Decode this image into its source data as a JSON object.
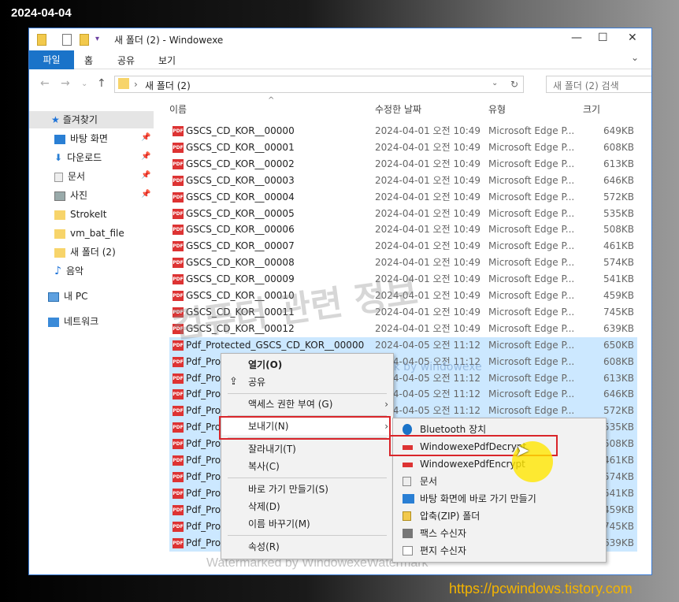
{
  "date_stamp": "2024-04-04",
  "site_url": "https://pcwindows.tistory.com",
  "window": {
    "title": "새 폴더 (2)  - Windowexe"
  },
  "ribbon": {
    "tabs": [
      "파일",
      "홈",
      "공유",
      "보기"
    ]
  },
  "address": {
    "path": "새 폴더 (2)",
    "search_placeholder": "새 폴더 (2) 검색"
  },
  "sidebar": {
    "items": [
      {
        "label": "즐겨찾기",
        "icon": "star-icon",
        "pinned": false
      },
      {
        "label": "바탕 화면",
        "icon": "desktop-icon",
        "pinned": true
      },
      {
        "label": "다운로드",
        "icon": "download-icon",
        "pinned": true
      },
      {
        "label": "문서",
        "icon": "document-icon",
        "pinned": true
      },
      {
        "label": "사진",
        "icon": "picture-icon",
        "pinned": true
      },
      {
        "label": "StrokeIt",
        "icon": "folder-icon",
        "pinned": false
      },
      {
        "label": "vm_bat_file",
        "icon": "folder-icon",
        "pinned": false
      },
      {
        "label": "새 폴더 (2)",
        "icon": "folder-icon",
        "pinned": false
      },
      {
        "label": "음악",
        "icon": "music-icon",
        "pinned": false
      },
      {
        "label": "내 PC",
        "icon": "pc-icon",
        "pinned": false
      },
      {
        "label": "네트워크",
        "icon": "network-icon",
        "pinned": false
      }
    ]
  },
  "columns": {
    "name": "이름",
    "date": "수정한 날짜",
    "type": "유형",
    "size": "크기"
  },
  "files": [
    {
      "name": "GSCS_CD_KOR__00000",
      "date": "2024-04-01 오전 10:49",
      "type": "Microsoft Edge P...",
      "size": "649KB"
    },
    {
      "name": "GSCS_CD_KOR__00001",
      "date": "2024-04-01 오전 10:49",
      "type": "Microsoft Edge P...",
      "size": "608KB"
    },
    {
      "name": "GSCS_CD_KOR__00002",
      "date": "2024-04-01 오전 10:49",
      "type": "Microsoft Edge P...",
      "size": "613KB"
    },
    {
      "name": "GSCS_CD_KOR__00003",
      "date": "2024-04-01 오전 10:49",
      "type": "Microsoft Edge P...",
      "size": "646KB"
    },
    {
      "name": "GSCS_CD_KOR__00004",
      "date": "2024-04-01 오전 10:49",
      "type": "Microsoft Edge P...",
      "size": "572KB"
    },
    {
      "name": "GSCS_CD_KOR__00005",
      "date": "2024-04-01 오전 10:49",
      "type": "Microsoft Edge P...",
      "size": "535KB"
    },
    {
      "name": "GSCS_CD_KOR__00006",
      "date": "2024-04-01 오전 10:49",
      "type": "Microsoft Edge P...",
      "size": "508KB"
    },
    {
      "name": "GSCS_CD_KOR__00007",
      "date": "2024-04-01 오전 10:49",
      "type": "Microsoft Edge P...",
      "size": "461KB"
    },
    {
      "name": "GSCS_CD_KOR__00008",
      "date": "2024-04-01 오전 10:49",
      "type": "Microsoft Edge P...",
      "size": "574KB"
    },
    {
      "name": "GSCS_CD_KOR__00009",
      "date": "2024-04-01 오전 10:49",
      "type": "Microsoft Edge P...",
      "size": "541KB"
    },
    {
      "name": "GSCS_CD_KOR__00010",
      "date": "2024-04-01 오전 10:49",
      "type": "Microsoft Edge P...",
      "size": "459KB"
    },
    {
      "name": "GSCS_CD_KOR__00011",
      "date": "2024-04-01 오전 10:49",
      "type": "Microsoft Edge P...",
      "size": "745KB"
    },
    {
      "name": "GSCS_CD_KOR__00012",
      "date": "2024-04-01 오전 10:49",
      "type": "Microsoft Edge P...",
      "size": "639KB"
    },
    {
      "name": "Pdf_Protected_GSCS_CD_KOR__00000",
      "date": "2024-04-05 오전 11:12",
      "type": "Microsoft Edge P...",
      "size": "650KB"
    },
    {
      "name": "Pdf_Prot",
      "date": "2024-04-05 오전 11:12",
      "type": "Microsoft Edge P...",
      "size": "608KB"
    },
    {
      "name": "Pdf_Prot",
      "date": "2024-04-05 오전 11:12",
      "type": "Microsoft Edge P...",
      "size": "613KB"
    },
    {
      "name": "Pdf_Prot",
      "date": "2024-04-05 오전 11:12",
      "type": "Microsoft Edge P...",
      "size": "646KB"
    },
    {
      "name": "Pdf_Prot",
      "date": "2024-04-05 오전 11:12",
      "type": "Microsoft Edge P...",
      "size": "572KB"
    },
    {
      "name": "Pdf_Prot",
      "date": "",
      "type": "",
      "size": "535KB"
    },
    {
      "name": "Pdf_Prot",
      "date": "",
      "type": "",
      "size": "508KB"
    },
    {
      "name": "Pdf_Prot",
      "date": "",
      "type": "",
      "size": "461KB"
    },
    {
      "name": "Pdf_Prot",
      "date": "",
      "type": "",
      "size": "574KB"
    },
    {
      "name": "Pdf_Prot",
      "date": "",
      "type": "",
      "size": "541KB"
    },
    {
      "name": "Pdf_Prot",
      "date": "",
      "type": "",
      "size": "459KB"
    },
    {
      "name": "Pdf_Prot",
      "date": "",
      "type": "",
      "size": "745KB"
    },
    {
      "name": "Pdf_Prot",
      "date": "",
      "type": "",
      "size": "639KB"
    }
  ],
  "context_menu": {
    "items": [
      "열기(O)",
      "공유",
      "액세스 권한 부여 (G)",
      "보내기(N)",
      "잘라내기(T)",
      "복사(C)",
      "바로 가기 만들기(S)",
      "삭제(D)",
      "이름 바꾸기(M)",
      "속성(R)"
    ]
  },
  "sendto_menu": {
    "items": [
      {
        "label": "Bluetooth 장치",
        "icon": "bluetooth-icon"
      },
      {
        "label": "WindowexePdfDecrypt",
        "icon": "pdf-icon"
      },
      {
        "label": "WindowexePdfEncrypt",
        "icon": "pdf-icon"
      },
      {
        "label": "문서",
        "icon": "document-icon"
      },
      {
        "label": "바탕 화면에 바로 가기 만들기",
        "icon": "desktop-icon"
      },
      {
        "label": "압축(ZIP) 폴더",
        "icon": "zip-folder-icon"
      },
      {
        "label": "팩스 수신자",
        "icon": "fax-icon"
      },
      {
        "label": "편지 수신자",
        "icon": "mail-icon"
      }
    ]
  },
  "watermarks": {
    "big": "컴퓨터 관련 정보",
    "mid": "watermark by windowexe",
    "bottom": "Watermarked by WindowexeWatermark"
  },
  "colors": {
    "accent": "#1a73c9",
    "selection": "#cce8ff",
    "highlight_box": "#d9252a",
    "url_text": "#f4b400"
  }
}
